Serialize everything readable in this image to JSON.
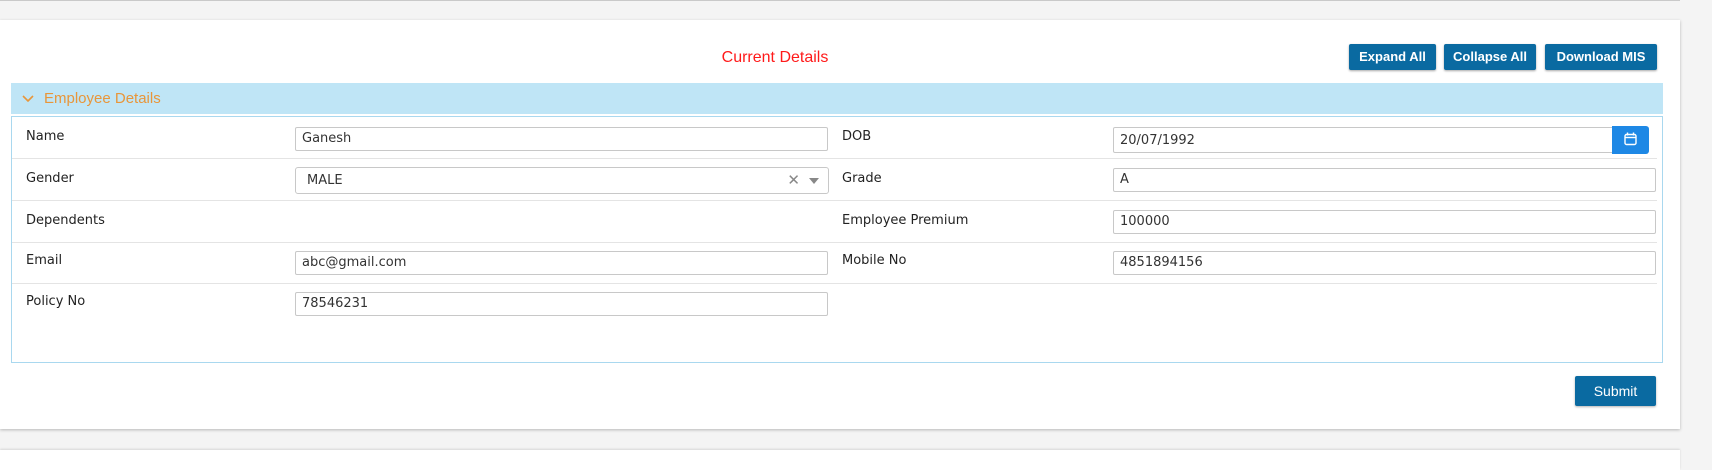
{
  "header": {
    "title": "Current Details",
    "expand_all": "Expand All",
    "collapse_all": "Collapse All",
    "download_mis": "Download MIS"
  },
  "panel": {
    "title": "Employee Details",
    "fields": {
      "name": {
        "label": "Name",
        "value": "Ganesh"
      },
      "dob": {
        "label": "DOB",
        "value": "20/07/1992"
      },
      "gender": {
        "label": "Gender",
        "value": "MALE"
      },
      "grade": {
        "label": "Grade",
        "value": "A"
      },
      "dependents": {
        "label": "Dependents"
      },
      "employee_premium": {
        "label": "Employee Premium",
        "value": "100000"
      },
      "email": {
        "label": "Email",
        "value": "abc@gmail.com"
      },
      "mobile_no": {
        "label": "Mobile No",
        "value": "4851894156"
      },
      "policy_no": {
        "label": "Policy No",
        "value": "78546231"
      }
    }
  },
  "footer": {
    "submit": "Submit"
  },
  "colors": {
    "accent": "#0a6aa1",
    "title": "#ff1a1a",
    "panel_header_bg": "#bfe5f6",
    "panel_title": "#e8963a",
    "calendar_button": "#1e88e5"
  },
  "icons": {
    "panel_toggle": "chevron-down-icon",
    "dob_picker": "calendar-icon",
    "gender_clear": "close-icon",
    "gender_dropdown": "caret-down-icon"
  }
}
